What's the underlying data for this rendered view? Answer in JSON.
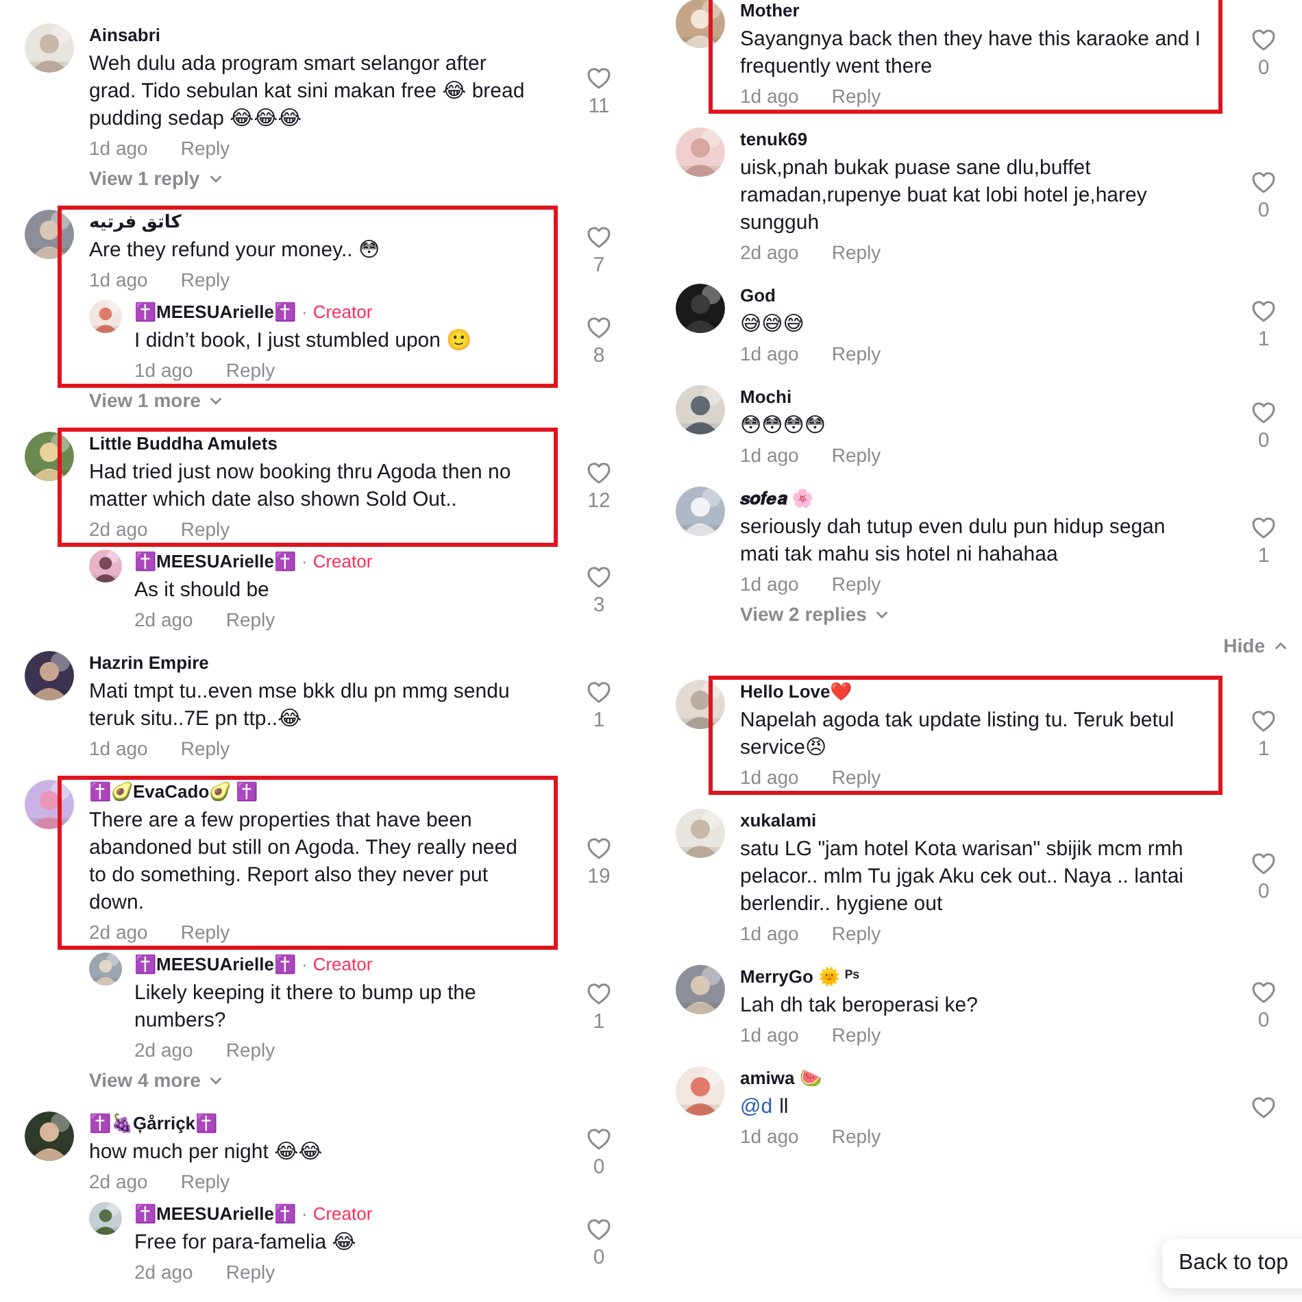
{
  "columns": [
    {
      "items": [
        {
          "kind": "comment",
          "username": "Ainsabri",
          "text": "Weh dulu ada program smart selangor after grad. Tido sebulan kat sini makan free 😂 bread pudding sedap 😂😂😂",
          "time": "1d ago",
          "reply": "Reply",
          "likes": "11",
          "highlighted": false,
          "more": "View 1 reply"
        },
        {
          "kind": "comment",
          "username": "كاتق فرتيه",
          "text": "Are they refund your money.. 😳",
          "time": "1d ago",
          "reply": "Reply",
          "likes": "7",
          "highlighted": true,
          "more": "View 1 more",
          "replies": [
            {
              "username": "✝️MEESUArielle✝️",
              "separator": "·",
              "tag": "Creator",
              "text": "I didn’t book, I just stumbled upon 🙂",
              "time": "1d ago",
              "reply": "Reply",
              "likes": "8",
              "highlighted": true
            }
          ]
        },
        {
          "kind": "comment",
          "username": "Little Buddha Amulets",
          "text": "Had tried just now booking thru Agoda then no matter which date also shown Sold Out..",
          "time": "2d ago",
          "reply": "Reply",
          "likes": "12",
          "highlighted": true,
          "replies": [
            {
              "username": "✝️MEESUArielle✝️",
              "separator": "·",
              "tag": "Creator",
              "text": "As it should be",
              "time": "2d ago",
              "reply": "Reply",
              "likes": "3",
              "highlighted": false
            }
          ]
        },
        {
          "kind": "comment",
          "username": "Hazrin Empire",
          "text": "Mati tmpt tu..even mse bkk dlu pn mmg sendu teruk situ..7E pn ttp..😂",
          "time": "1d ago",
          "reply": "Reply",
          "likes": "1",
          "highlighted": false
        },
        {
          "kind": "comment",
          "username": "✝️🥑EvaCado🥑 ✝️",
          "text": "There are a few properties that have been abandoned but still on Agoda. They really need to do something. Report also they never put down.",
          "time": "2d ago",
          "reply": "Reply",
          "likes": "19",
          "highlighted": true,
          "more": "View 4 more",
          "replies": [
            {
              "username": "✝️MEESUArielle✝️",
              "separator": "·",
              "tag": "Creator",
              "text": "Likely keeping it there to bump up the numbers?",
              "time": "2d ago",
              "reply": "Reply",
              "likes": "1",
              "highlighted": false
            }
          ]
        },
        {
          "kind": "comment",
          "username": "✝️🍇Ģårriçk✝️",
          "text": "how much per night 😂😂",
          "time": "2d ago",
          "reply": "Reply",
          "likes": "0",
          "highlighted": false,
          "replies": [
            {
              "username": "✝️MEESUArielle✝️",
              "separator": "·",
              "tag": "Creator",
              "text": "Free for para-famelia 😂",
              "time": "2d ago",
              "reply": "Reply",
              "likes": "0",
              "highlighted": false
            }
          ]
        }
      ]
    },
    {
      "items": [
        {
          "kind": "comment",
          "username": "Mother",
          "text": "Sayangnya back then they have this karaoke and I frequently went there",
          "time": "1d ago",
          "reply": "Reply",
          "likes": "0",
          "highlighted": true
        },
        {
          "kind": "comment",
          "username": "tenuk69",
          "text": "uisk,pnah bukak puase sane dlu,buffet ramadan,rupenye buat kat lobi hotel je,harey sungguh",
          "time": "2d ago",
          "reply": "Reply",
          "likes": "0",
          "highlighted": false
        },
        {
          "kind": "comment",
          "username": "God",
          "text": "😅😅😅",
          "time": "1d ago",
          "reply": "Reply",
          "likes": "1",
          "highlighted": false
        },
        {
          "kind": "comment",
          "username": "Mochi",
          "text": "😳😳😳😳",
          "time": "1d ago",
          "reply": "Reply",
          "likes": "0",
          "highlighted": false
        },
        {
          "kind": "comment",
          "username": "𝒔𝒐𝒇𝒆𝒂 🌸",
          "text": "seriously dah tutup even dulu pun hidup segan mati tak mahu sis hotel ni hahahaa",
          "time": "1d ago",
          "reply": "Reply",
          "likes": "1",
          "highlighted": false,
          "more": "View 2 replies"
        },
        {
          "kind": "hide",
          "label": "Hide"
        },
        {
          "kind": "comment",
          "username": "Hello Love❤️",
          "text": "Napelah agoda tak update listing tu. Teruk betul service😠",
          "time": "1d ago",
          "reply": "Reply",
          "likes": "1",
          "highlighted": true
        },
        {
          "kind": "comment",
          "username": "xukalami",
          "text": "satu LG \"jam hotel Kota warisan\" sbijik mcm rmh pelacor.. mlm Tu jgak Aku cek out.. Naya .. lantai berlendir.. hygiene out",
          "time": "1d ago",
          "reply": "Reply",
          "likes": "0",
          "highlighted": false
        },
        {
          "kind": "comment",
          "username": "MerryGo 🌞 ᴾˢ",
          "text": "Lah dh tak beroperasi ke?",
          "time": "1d ago",
          "reply": "Reply",
          "likes": "0",
          "highlighted": false
        },
        {
          "kind": "comment",
          "username": "amiwa 🍉",
          "mention": "@d",
          "text": "ll",
          "time": "1d ago",
          "reply": "Reply",
          "highlighted": false
        }
      ]
    }
  ],
  "back_to_top": "Back to top"
}
